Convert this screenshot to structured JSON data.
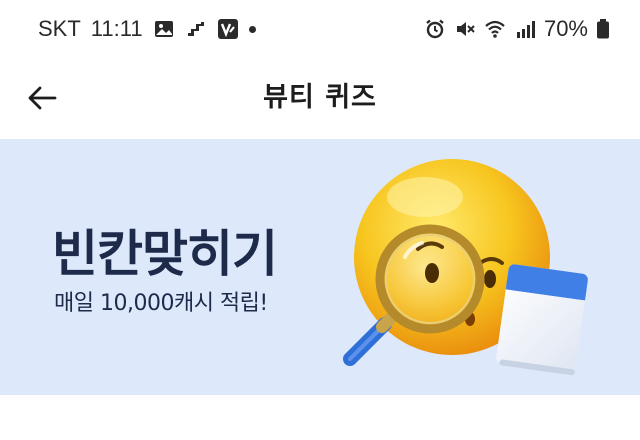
{
  "status_bar": {
    "carrier": "SKT",
    "time": "11:11",
    "battery": "70%",
    "left_icons": [
      "gallery-icon",
      "stairs-icon",
      "v-app-icon",
      "dot-icon"
    ],
    "right_icons": [
      "alarm-icon",
      "mute-icon",
      "wifi-icon",
      "signal-icon",
      "battery-icon"
    ]
  },
  "header": {
    "title": "뷰티 퀴즈",
    "back_icon": "arrow-left-icon"
  },
  "banner": {
    "title": "빈칸맞히기",
    "subtitle": "매일 10,000캐시 적립!",
    "background_color": "#dde9fb",
    "text_color": "#1e2a4a",
    "illustration": [
      "emoji-face-icon",
      "magnifying-glass-icon",
      "calendar-icon"
    ]
  },
  "colors": {
    "background": "#ffffff",
    "emoji_yellow": "#f5c21c",
    "glass_handle": "#2f6fd8",
    "calendar_blue": "#3f7fe6"
  }
}
